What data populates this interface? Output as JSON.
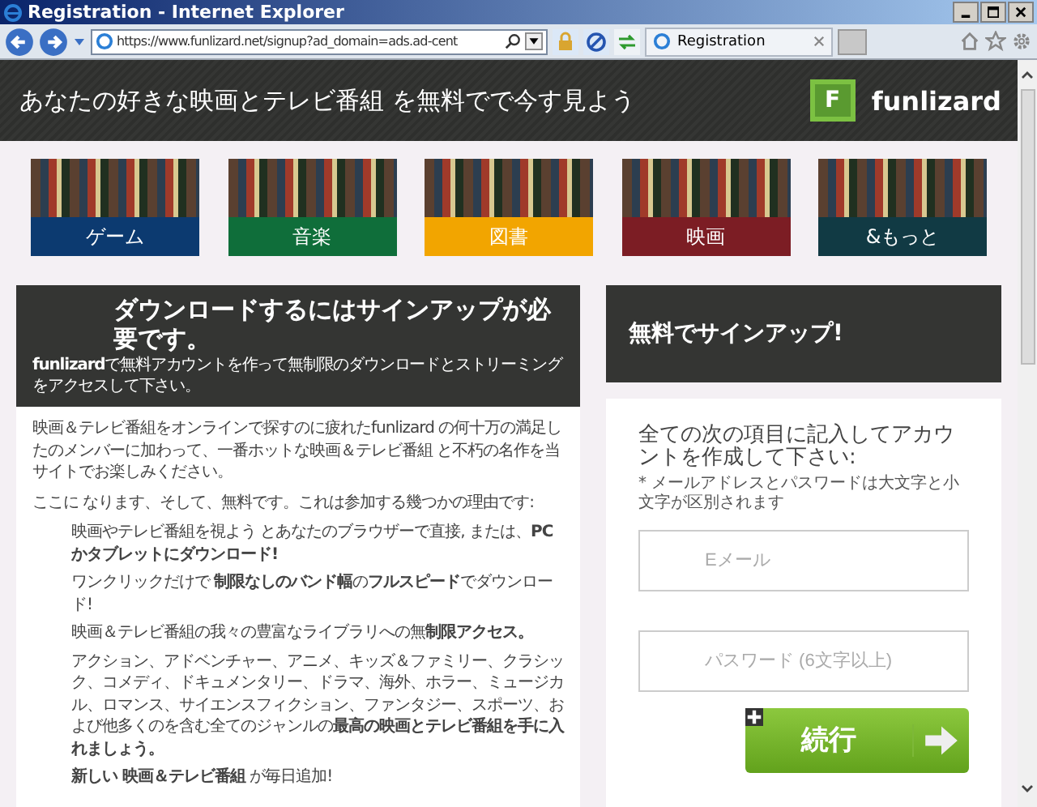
{
  "window": {
    "title": "Registration - Internet Explorer"
  },
  "address_bar": {
    "value": "https://www.funlizard.net/signup?ad_domain=ads.ad-cent"
  },
  "tabs": [
    {
      "label": "Registration",
      "selected": true
    }
  ],
  "header": {
    "tagline": "あなたの好きな映画とテレビ番組 を無料でで今す見よう",
    "logo_letter": "F",
    "brand": "funlizard"
  },
  "categories": [
    {
      "label": "ゲーム",
      "color": "#0c3a70"
    },
    {
      "label": "音楽",
      "color": "#0f6e3a"
    },
    {
      "label": "図書",
      "color": "#f2a500"
    },
    {
      "label": "映画",
      "color": "#7c1d24"
    },
    {
      "label": "&もっと",
      "color": "#113a44"
    }
  ],
  "info_panel": {
    "title": "ダウンロードするにはサインアップが必要です。",
    "subtitle": "**funlizard**で無料アカウントを作って無制限のダウンロードとストリーミングをアクセスして下さい。",
    "paragraphs": [
      "映画＆テレビ番組をオンラインで探すのに疲れたfunlizard の何十万の満足したのメンバーに加わって、一番ホットな映画＆テレビ番組 と不朽の名作を当サイトでお楽しみください。",
      "ここに なります、そして、無料です。これは参加する幾つかの理由です:"
    ],
    "reasons": [
      "映画やテレビ番組を視よう とあなたのブラウザーで直接, または、**PCかタブレットにダウンロード!**",
      "ワンクリックだけで **制限なしのバンド幅**の**フルスピード**でダウンロード!",
      "映画＆テレビ番組の我々の豊富なライブラリへの無**制限アクセス。**",
      "アクション、アドベンチャー、アニメ、キッズ＆ファミリー、クラシック、コメディ、ドキュメンタリー、ドラマ、海外、ホラー、ミュージカル、ロマンス、サイエンスフィクション、ファンタジー、スポーツ、および他多くのを含む全てのジャンルの**最高の映画とテレビ番組を手に入れましょう。**",
      "**新しい 映画＆テレビ番組** が毎日追加!"
    ]
  },
  "signup_panel": {
    "title": "無料でサインアップ!",
    "heading": "全ての次の項目に記入してアカウントを作成して下さい:",
    "note": "* メールアドレスとパスワードは大文字と小文字が区別されます",
    "fields": [
      {
        "placeholder": "Eメール"
      },
      {
        "placeholder": "パスワード (6文字以上)"
      }
    ],
    "submit": "続行"
  }
}
